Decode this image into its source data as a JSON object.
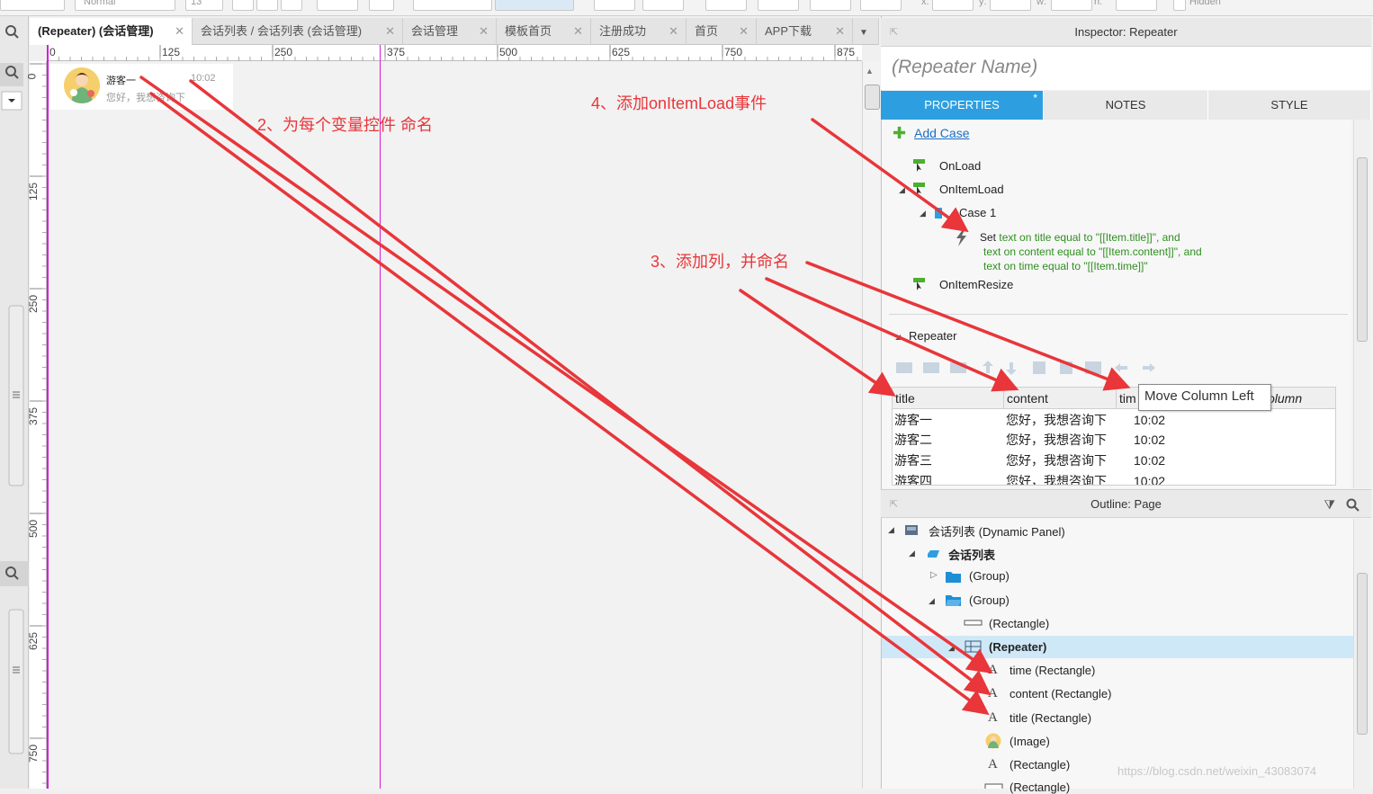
{
  "toolbar": {
    "style_value": "Normal",
    "font_size": "13",
    "x_label": "x:",
    "y_label": "y:",
    "w_label": "w:",
    "h_label": "h:",
    "hidden_label": "Hidden"
  },
  "tabs": [
    {
      "label": "(Repeater) (会话管理)",
      "active": true
    },
    {
      "label": "会话列表 / 会话列表 (会话管理)"
    },
    {
      "label": "会话管理"
    },
    {
      "label": "模板首页"
    },
    {
      "label": "注册成功"
    },
    {
      "label": "首页"
    },
    {
      "label": "APP下载"
    }
  ],
  "ruler": {
    "h_marks": [
      "0",
      "125",
      "250",
      "375",
      "500",
      "625",
      "750",
      "875"
    ],
    "v_marks": [
      "0",
      "125",
      "250",
      "375",
      "500",
      "625",
      "750"
    ]
  },
  "canvas_item": {
    "title": "游客一",
    "time": "10:02",
    "content": "您好，我想咨询下"
  },
  "annotations": {
    "a2": "2、为每个变量控件 命名",
    "a3": "3、添加列，并命名",
    "a4": "4、添加onItemLoad事件"
  },
  "inspector": {
    "header": "Inspector: Repeater",
    "name_placeholder": "(Repeater Name)",
    "tabs": [
      "PROPERTIES",
      "NOTES",
      "STYLE"
    ],
    "tab_marker": "*",
    "add_case": "Add Case",
    "events": {
      "onload": "OnLoad",
      "onitemload": "OnItemLoad",
      "case1": "Case 1",
      "action_set": "Set",
      "action_line1": "text on title equal to \"[[Item.title]]\", and",
      "action_line2": "text on content equal to \"[[Item.content]]\", and",
      "action_line3": "text on time equal to \"[[Item.time]]\"",
      "onitemresize": "OnItemResize"
    },
    "repeater_section": "Repeater",
    "grid_headers": [
      "title",
      "content",
      "tim"
    ],
    "grid_header_extra": "olumn",
    "grid_rows": [
      [
        "游客一",
        "您好，我想咨询下",
        "10:02"
      ],
      [
        "游客二",
        "您好，我想咨询下",
        "10:02"
      ],
      [
        "游客三",
        "您好，我想咨询下",
        "10:02"
      ],
      [
        "游客四",
        "您好，我想咨询下",
        "10:02"
      ]
    ],
    "tooltip": "Move Column Left"
  },
  "outline": {
    "header": "Outline: Page",
    "items": [
      {
        "label": "会话列表 (Dynamic Panel)",
        "icon": "dynamic-panel-icon"
      },
      {
        "label": "会话列表",
        "icon": "state-icon",
        "bold": true
      },
      {
        "label": "(Group)",
        "icon": "folder-icon"
      },
      {
        "label": "(Group)",
        "icon": "folder-open-icon"
      },
      {
        "label": "(Rectangle)",
        "icon": "rectangle-icon"
      },
      {
        "label": "(Repeater)",
        "icon": "repeater-icon",
        "bold": true,
        "selected": true
      },
      {
        "label": "time (Rectangle)",
        "icon": "text-icon"
      },
      {
        "label": "content (Rectangle)",
        "icon": "text-icon"
      },
      {
        "label": "title (Rectangle)",
        "icon": "text-icon"
      },
      {
        "label": "(Image)",
        "icon": "image-icon"
      },
      {
        "label": "(Rectangle)",
        "icon": "text-icon"
      },
      {
        "label": "(Rectangle)",
        "icon": "rectangle-icon"
      }
    ]
  },
  "watermark": "https://blog.csdn.net/weixin_43083074",
  "colors": {
    "accent": "#2d9fe0",
    "annotation": "#e8363a",
    "guide": "#d81bd8",
    "action_text": "#2f8f1f",
    "selected_row": "#cfe8f7"
  }
}
